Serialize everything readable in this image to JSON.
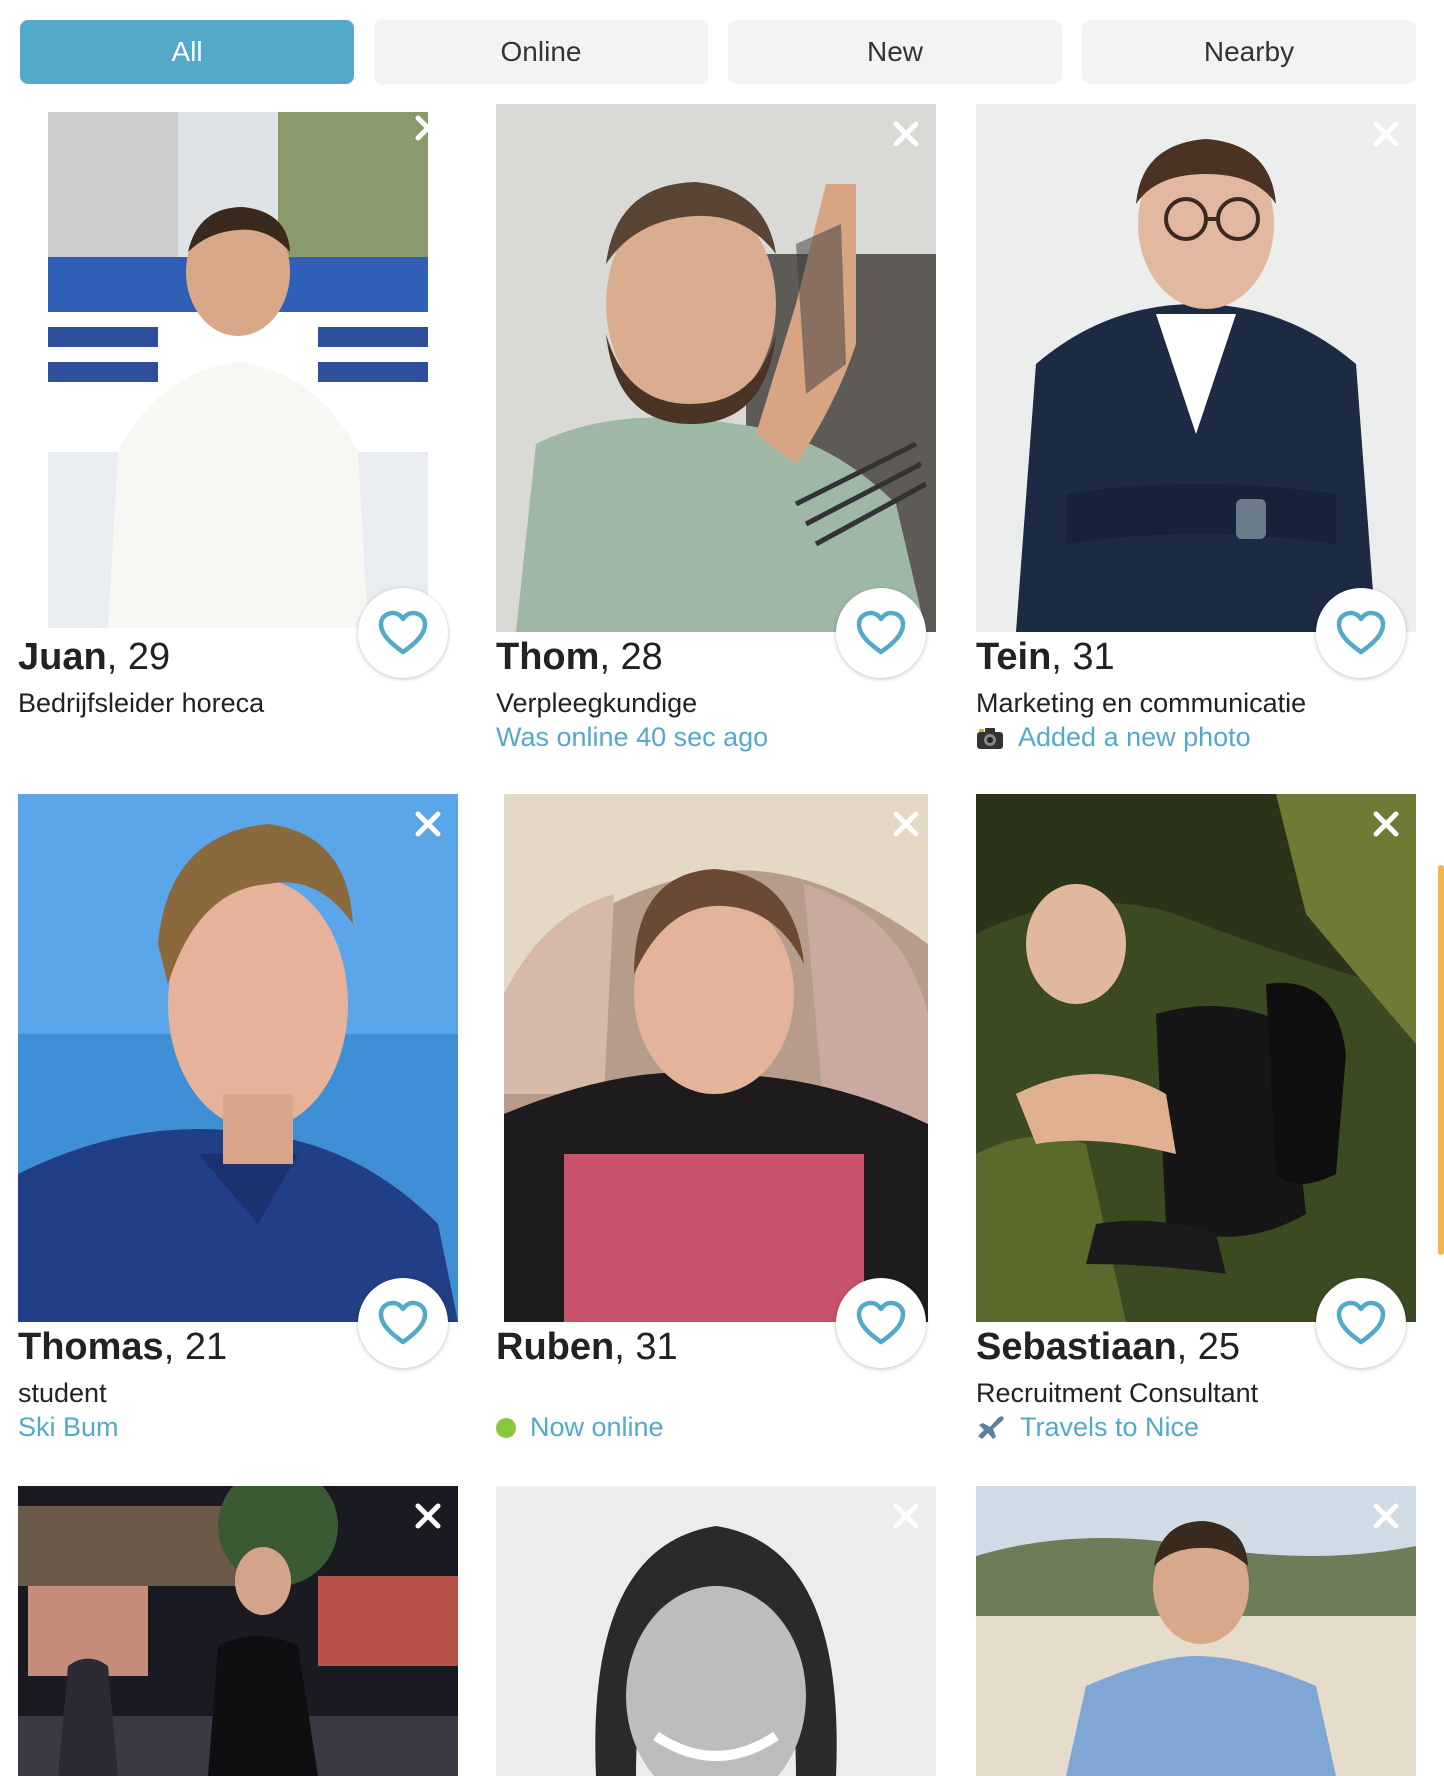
{
  "tabs": [
    {
      "label": "All",
      "active": true
    },
    {
      "label": "Online",
      "active": false
    },
    {
      "label": "New",
      "active": false
    },
    {
      "label": "Nearby",
      "active": false
    }
  ],
  "profiles": [
    {
      "name": "Juan",
      "age": ", 29",
      "job": "Bedrijfsleider horeca",
      "status": ""
    },
    {
      "name": "Thom",
      "age": ", 28",
      "job": "Verpleegkundige",
      "status": "Was online 40 sec ago"
    },
    {
      "name": "Tein",
      "age": ", 31",
      "job": "Marketing en communicatie",
      "status": "Added a new photo",
      "status_icon": "camera-icon"
    },
    {
      "name": "Thomas",
      "age": ", 21",
      "job": "student",
      "status": "Ski Bum"
    },
    {
      "name": "Ruben",
      "age": ", 31",
      "job": "",
      "status": "Now online",
      "status_icon": "online-dot-icon"
    },
    {
      "name": "Sebastiaan",
      "age": ", 25",
      "job": "Recruitment Consultant",
      "status": "Travels to Nice",
      "status_icon": "airplane-icon"
    }
  ],
  "colors": {
    "accent": "#54a9c8",
    "online": "#8cc63f",
    "tab_bg": "#f3f3f3"
  }
}
